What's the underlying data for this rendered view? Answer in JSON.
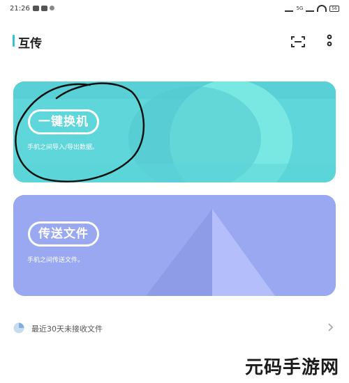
{
  "status_bar": {
    "time": "21:26",
    "network_label": "5G",
    "battery": "56"
  },
  "header": {
    "title": "互传",
    "accent_color": "#34c3cf",
    "actions": [
      {
        "icon": "scan-icon"
      },
      {
        "icon": "more-vertical-icon"
      }
    ]
  },
  "cards": [
    {
      "title": "一键换机",
      "description": "手机之间导入/导出数据。",
      "color": "#5fd6d9"
    },
    {
      "title": "传送文件",
      "description": "手机之间传送文件。",
      "color": "#9aa8f1"
    }
  ],
  "recent": {
    "label": "最近30天未接收文件",
    "icon": "pie-chart-icon"
  },
  "watermark": {
    "text": "元码手游网"
  }
}
